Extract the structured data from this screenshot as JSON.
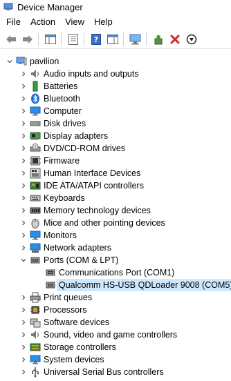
{
  "window": {
    "title": "Device Manager"
  },
  "menu": [
    {
      "label": "File"
    },
    {
      "label": "Action"
    },
    {
      "label": "View"
    },
    {
      "label": "Help"
    }
  ],
  "toolbar": [
    {
      "icon": "back-arrow-icon"
    },
    {
      "icon": "forward-arrow-icon"
    },
    {
      "icon": "separator"
    },
    {
      "icon": "show-hide-console-tree-icon"
    },
    {
      "icon": "separator"
    },
    {
      "icon": "properties-icon"
    },
    {
      "icon": "separator"
    },
    {
      "icon": "help-icon"
    },
    {
      "icon": "action-pane-icon"
    },
    {
      "icon": "separator"
    },
    {
      "icon": "scan-hardware-icon"
    },
    {
      "icon": "separator"
    },
    {
      "icon": "update-driver-icon"
    },
    {
      "icon": "uninstall-device-icon"
    },
    {
      "icon": "disable-device-icon"
    }
  ],
  "tree": {
    "root": {
      "label": "pavilion",
      "expanded": true
    },
    "categories": [
      {
        "label": "Audio inputs and outputs",
        "icon": "speaker-icon",
        "expanded": false
      },
      {
        "label": "Batteries",
        "icon": "battery-icon",
        "expanded": false
      },
      {
        "label": "Bluetooth",
        "icon": "bluetooth-icon",
        "expanded": false
      },
      {
        "label": "Computer",
        "icon": "computer-icon",
        "expanded": false
      },
      {
        "label": "Disk drives",
        "icon": "disk-drive-icon",
        "expanded": false
      },
      {
        "label": "Display adapters",
        "icon": "display-adapter-icon",
        "expanded": false
      },
      {
        "label": "DVD/CD-ROM drives",
        "icon": "dvd-drive-icon",
        "expanded": false
      },
      {
        "label": "Firmware",
        "icon": "firmware-icon",
        "expanded": false
      },
      {
        "label": "Human Interface Devices",
        "icon": "hid-icon",
        "expanded": false
      },
      {
        "label": "IDE ATA/ATAPI controllers",
        "icon": "ide-controller-icon",
        "expanded": false
      },
      {
        "label": "Keyboards",
        "icon": "keyboard-icon",
        "expanded": false
      },
      {
        "label": "Memory technology devices",
        "icon": "memory-icon",
        "expanded": false
      },
      {
        "label": "Mice and other pointing devices",
        "icon": "mouse-icon",
        "expanded": false
      },
      {
        "label": "Monitors",
        "icon": "monitor-icon",
        "expanded": false
      },
      {
        "label": "Network adapters",
        "icon": "network-adapter-icon",
        "expanded": false
      },
      {
        "label": "Ports (COM & LPT)",
        "icon": "port-icon",
        "expanded": true,
        "children": [
          {
            "label": "Communications Port (COM1)",
            "icon": "port-icon",
            "selected": false
          },
          {
            "label": "Qualcomm HS-USB QDLoader 9008 (COM5)",
            "icon": "port-icon",
            "selected": true
          }
        ]
      },
      {
        "label": "Print queues",
        "icon": "printer-icon",
        "expanded": false
      },
      {
        "label": "Processors",
        "icon": "processor-icon",
        "expanded": false
      },
      {
        "label": "Software devices",
        "icon": "software-device-icon",
        "expanded": false
      },
      {
        "label": "Sound, video and game controllers",
        "icon": "sound-icon",
        "expanded": false
      },
      {
        "label": "Storage controllers",
        "icon": "storage-controller-icon",
        "expanded": false
      },
      {
        "label": "System devices",
        "icon": "system-device-icon",
        "expanded": false
      },
      {
        "label": "Universal Serial Bus controllers",
        "icon": "usb-icon",
        "expanded": false
      }
    ]
  },
  "colors": {
    "selection": "#cce8ff",
    "accent_blue": "#2b7bd1"
  }
}
